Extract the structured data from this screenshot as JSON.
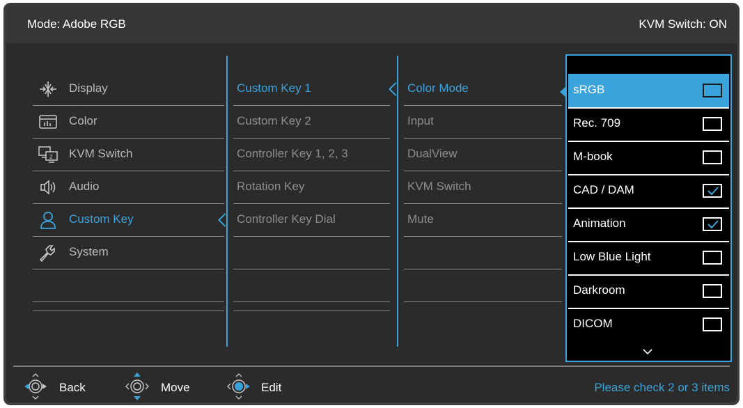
{
  "header": {
    "mode_label": "Mode: Adobe RGB",
    "kvm_status": "KVM Switch: ON"
  },
  "main_menu": {
    "items": [
      {
        "label": "Display",
        "icon": "display-icon"
      },
      {
        "label": "Color",
        "icon": "color-icon"
      },
      {
        "label": "KVM Switch",
        "icon": "kvm-switch-icon"
      },
      {
        "label": "Audio",
        "icon": "audio-icon"
      },
      {
        "label": "Custom Key",
        "icon": "custom-key-icon",
        "selected": true
      },
      {
        "label": "System",
        "icon": "system-icon"
      }
    ]
  },
  "custom_key_menu": {
    "items": [
      {
        "label": "Custom Key 1",
        "selected": true
      },
      {
        "label": "Custom Key 2"
      },
      {
        "label": "Controller Key 1, 2, 3"
      },
      {
        "label": "Rotation Key"
      },
      {
        "label": "Controller Key Dial"
      }
    ]
  },
  "function_menu": {
    "items": [
      {
        "label": "Color Mode",
        "selected": true
      },
      {
        "label": "Input"
      },
      {
        "label": "DualView"
      },
      {
        "label": "KVM Switch"
      },
      {
        "label": "Mute"
      }
    ]
  },
  "color_mode_options": {
    "items": [
      {
        "label": "sRGB",
        "checked": false,
        "highlighted": true
      },
      {
        "label": "Rec. 709",
        "checked": false
      },
      {
        "label": "M-book",
        "checked": false
      },
      {
        "label": "CAD / DAM",
        "checked": true
      },
      {
        "label": "Animation",
        "checked": true
      },
      {
        "label": "Low Blue Light",
        "checked": false
      },
      {
        "label": "Darkroom",
        "checked": false
      },
      {
        "label": "DICOM",
        "checked": false
      }
    ],
    "more_indicator": "chevron-down-icon"
  },
  "footer": {
    "back_label": "Back",
    "move_label": "Move",
    "edit_label": "Edit",
    "hint": "Please check 2 or 3 items"
  },
  "colors": {
    "accent": "#3aa3dc",
    "background": "#2b2b2b",
    "header": "#363636",
    "text": "#ffffff",
    "muted_text": "#8e8e8e"
  }
}
